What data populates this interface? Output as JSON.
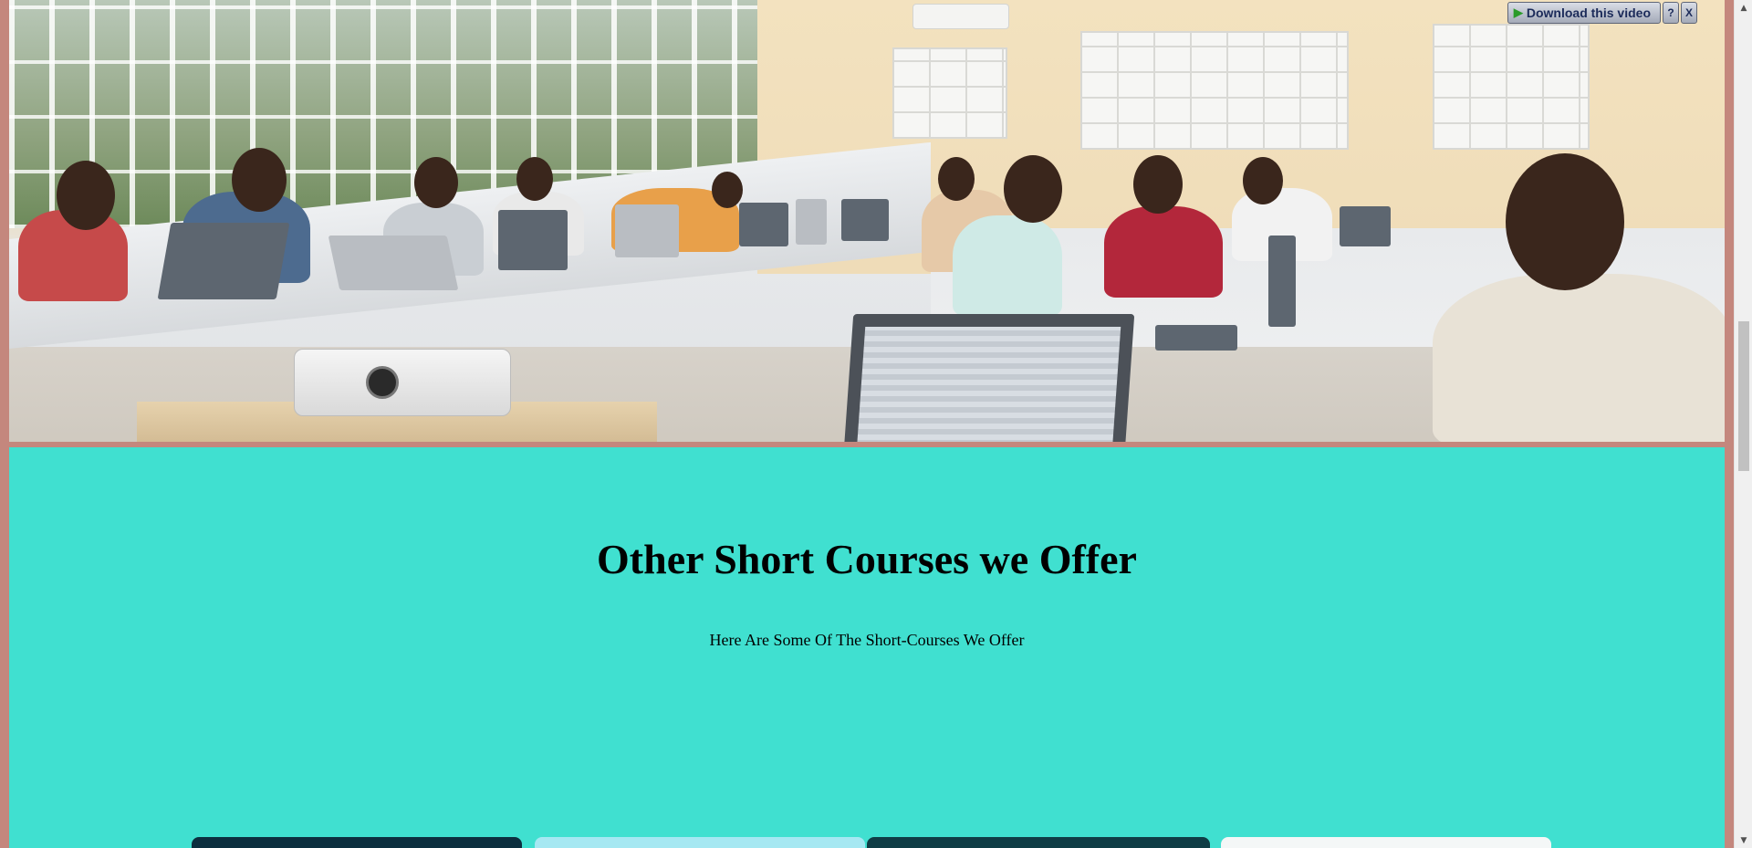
{
  "download_bar": {
    "button_label": "Download this video",
    "help_label": "?",
    "close_label": "X"
  },
  "courses": {
    "heading": "Other Short Courses we Offer",
    "subheading": "Here Are Some Of The Short-Courses We Offer"
  },
  "cards": [
    {
      "color": "#0c2f3f"
    },
    {
      "color": "#a6e8f2"
    },
    {
      "color": "#0f3d45"
    },
    {
      "color": "#f4f7f7"
    }
  ],
  "scrollbar": {
    "up_arrow": "▲",
    "down_arrow": "▼"
  }
}
